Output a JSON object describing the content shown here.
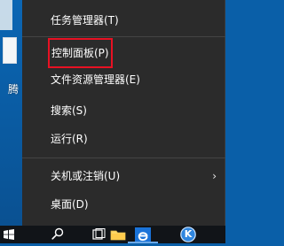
{
  "desktop": {
    "icon_label_fragment": "腾"
  },
  "context_menu": {
    "items": [
      {
        "label": "任务管理器(T)"
      },
      {
        "label": "控制面板(P)",
        "highlighted": true
      },
      {
        "label": "文件资源管理器(E)"
      },
      {
        "label": "搜索(S)"
      },
      {
        "label": "运行(R)"
      },
      {
        "label": "关机或注销(U)",
        "has_submenu": true
      },
      {
        "label": "桌面(D)"
      }
    ],
    "submenu_arrow": "›",
    "highlight_color": "#e81123"
  },
  "taskbar": {
    "icons": [
      "windows-start-icon",
      "search-icon",
      "task-view-icon",
      "file-explorer-icon",
      "edge-icon",
      "kugou-icon"
    ],
    "kugou_letter": "K"
  },
  "colors": {
    "menu_bg": "#2b2b2b",
    "taskbar_bg": "#111418",
    "desktop_bg": "#0a5fa8"
  }
}
